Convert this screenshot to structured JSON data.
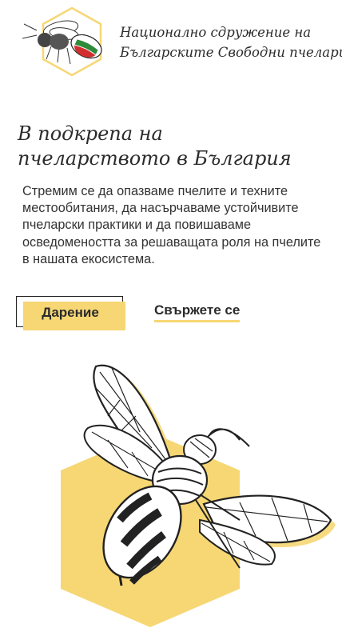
{
  "header": {
    "logo_icon": "bee-logo-icon",
    "org_name_line1": "Национално сдружение на",
    "org_name_line2": "Българските Свободни пчелари"
  },
  "hero": {
    "title_line1": "В подкрепа на",
    "title_line2": "пчеларството в България",
    "description": "Стремим се да опазваме пчелите и техните местообитания, да насърчаваме устойчивите пчеларски практики и да повишаваме осведомеността за решаващата роля на пчелите в нашата екосистема.",
    "donate_label": "Дарение",
    "contact_label": "Свържете се"
  },
  "illustration": {
    "icon": "bee-illustration-icon"
  },
  "colors": {
    "accent_yellow": "#f6d774",
    "text": "#2b2b2b",
    "flag_white": "#ffffff",
    "flag_green": "#2e8b3a",
    "flag_red": "#d22e2e"
  }
}
